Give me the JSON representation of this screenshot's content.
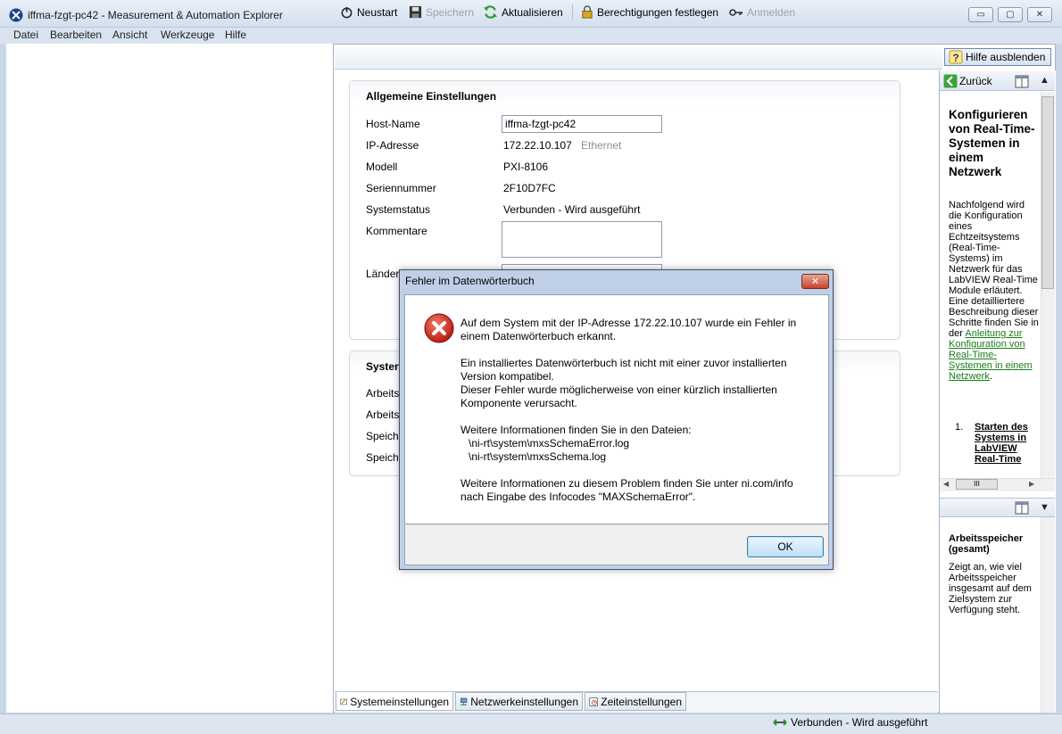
{
  "window": {
    "title": "iffma-fzgt-pc42 - Measurement & Automation Explorer",
    "minimize": "▭",
    "maximize": "▢",
    "close": "✕"
  },
  "menu": [
    "Datei",
    "Bearbeiten",
    "Ansicht",
    "Werkzeuge",
    "Hilfe"
  ],
  "toolbar": {
    "restart": "Neustart",
    "save": "Speichern",
    "refresh": "Aktualisieren",
    "permissions": "Berechtigungen festlegen",
    "login": "Anmelden",
    "hide_help": "Hilfe ausblenden"
  },
  "general": {
    "title": "Allgemeine Einstellungen",
    "host_label": "Host-Name",
    "host_value": "iffma-fzgt-pc42",
    "ip_label": "IP-Adresse",
    "ip_value": "172.22.10.107",
    "ip_type": "Ethernet",
    "model_label": "Modell",
    "model_value": "PXI-8106",
    "serial_label": "Seriennummer",
    "serial_value": "2F10D7FC",
    "status_label": "Systemstatus",
    "status_value": "Verbunden - Wird ausgeführt",
    "comments_label": "Kommentare",
    "locale_label": "Länder"
  },
  "system": {
    "title": "Syster",
    "row1": "Arbeits",
    "row2": "Arbeits",
    "row3": "Speich",
    "row4": "Speich"
  },
  "tabs": [
    "Systemeinstellungen",
    "Netzwerkeinstellungen",
    "Zeiteinstellungen"
  ],
  "help": {
    "back": "Zurück",
    "title": "Konfigurieren von Real-Time-Systemen in einem Netzwerk",
    "intro": "Nachfolgend wird die Konfiguration eines Echtzeitsystems (Real-Time-Systems) im Netzwerk für das LabVIEW Real-Time Module erläutert. Eine detailliertere Beschreibung dieser Schritte finden Sie in der",
    "link": "Anleitung zur Konfiguration von Real-Time-Systemen in einem Netzwerk",
    "period": ".",
    "step_number": "1.",
    "step1": "Starten des Systems in LabVIEW Real-Time",
    "scroll_thumb": "III",
    "section2_title": "Arbeitsspeicher (gesamt)",
    "section2_text": "Zeigt an, wie viel Arbeitsspeicher insgesamt auf dem Zielsystem zur Verfügung steht."
  },
  "status": {
    "text": "Verbunden - Wird ausgeführt"
  },
  "dialog": {
    "title": "Fehler im Datenwörterbuch",
    "line1": "Auf dem System mit der IP-Adresse 172.22.10.107 wurde ein Fehler in",
    "line2": "einem Datenwörterbuch erkannt.",
    "line3": "Ein installiertes Datenwörterbuch ist nicht mit einer zuvor installierten",
    "line4": "Version kompatibel.",
    "line5": "Dieser Fehler wurde möglicherweise von einer kürzlich installierten",
    "line6": "Komponente verursacht.",
    "line7": "Weitere Informationen finden Sie in den Dateien:",
    "line8": "\\ni-rt\\system\\mxsSchemaError.log",
    "line9": "\\ni-rt\\system\\mxsSchema.log",
    "line10": "Weitere Informationen zu diesem Problem finden Sie unter ni.com/info",
    "line11": "nach Eingabe des Infocodes \"MAXSchemaError\".",
    "ok": "OK"
  }
}
